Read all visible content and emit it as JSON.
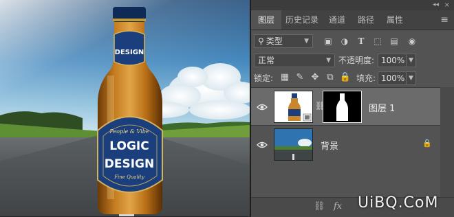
{
  "tabs": [
    "图层",
    "历史记录",
    "通道",
    "路径",
    "属性"
  ],
  "filter": {
    "icon": "search-icon",
    "value": "类型"
  },
  "blend_mode": "正常",
  "opacity": {
    "label": "不透明度:",
    "value": "100%"
  },
  "lock": {
    "label": "锁定:"
  },
  "fill": {
    "label": "填充:",
    "value": "100%"
  },
  "layers": [
    {
      "name": "图层 1",
      "selected": true
    },
    {
      "name": "背景",
      "selected": false
    }
  ],
  "bottom_bar": {
    "partial_text": "fx"
  },
  "bottle": {
    "label_script": "People & Vibe",
    "label_top": "LOGIC",
    "label_bottom": "DESIGN",
    "label_sub": "Fine Quality",
    "neck_label": "DESIGN"
  },
  "watermark": "UiBQ.CoM",
  "colors": {
    "panel": "#535353",
    "tab_bar": "#424242",
    "selected_layer": "#6b6b6b",
    "bottle_label": "#1c3f7a"
  }
}
